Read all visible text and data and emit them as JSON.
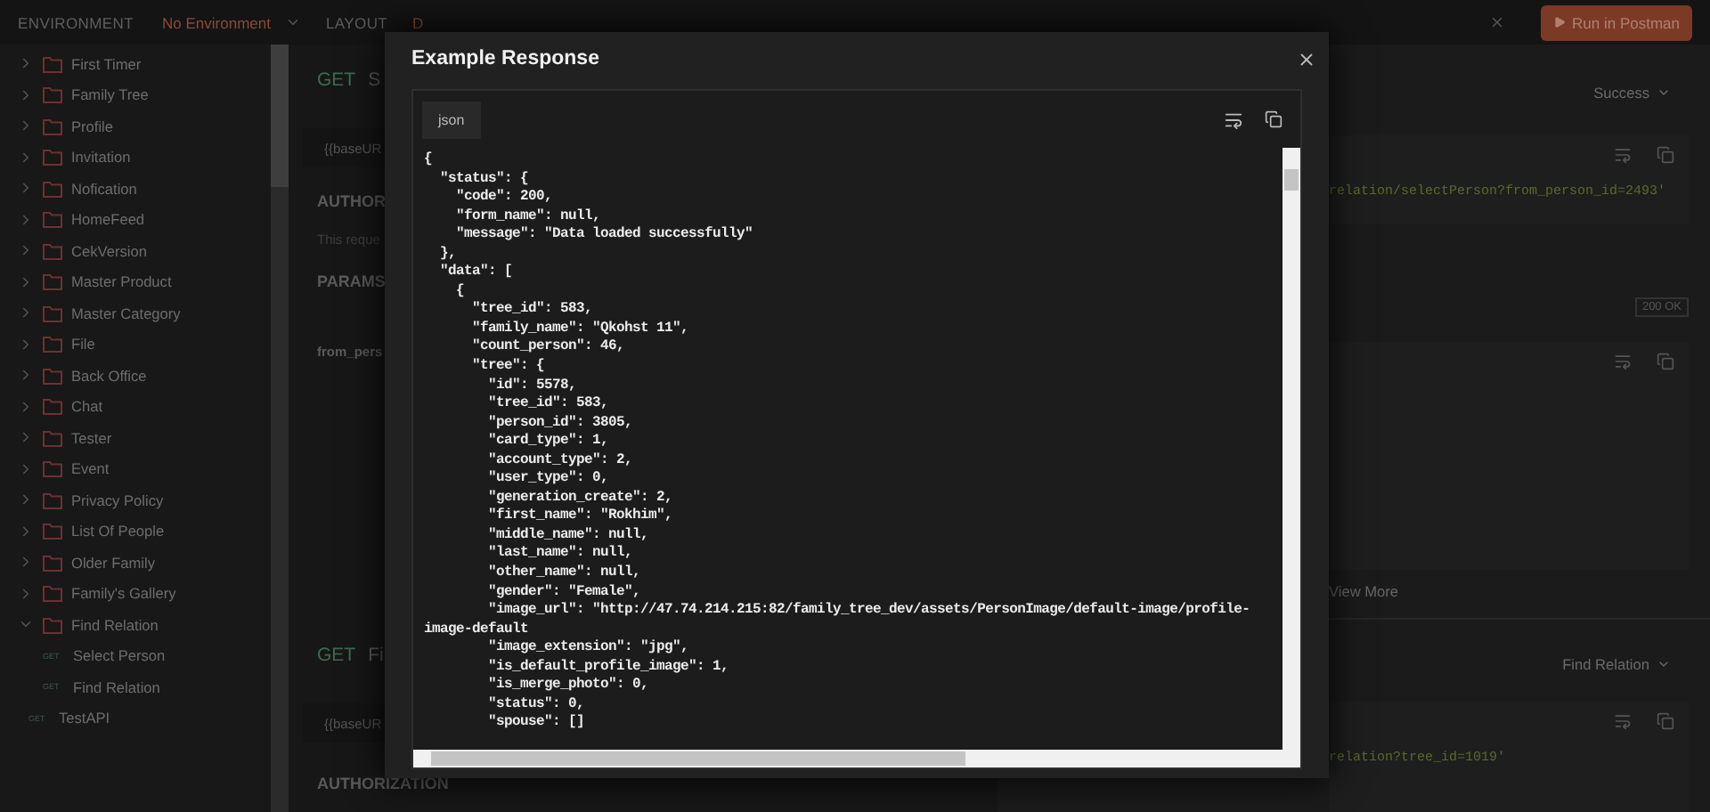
{
  "topbar": {
    "environment_label": "ENVIRONMENT",
    "environment_value": "No Environment",
    "layout_label": "LAYOUT",
    "layout_value": "D",
    "run_button": "Run in Postman"
  },
  "sidebar": {
    "items": [
      {
        "kind": "folder",
        "label": "First Timer",
        "expanded": false
      },
      {
        "kind": "folder",
        "label": "Family Tree",
        "expanded": false
      },
      {
        "kind": "folder",
        "label": "Profile",
        "expanded": false
      },
      {
        "kind": "folder",
        "label": "Invitation",
        "expanded": false
      },
      {
        "kind": "folder",
        "label": "Nofication",
        "expanded": false
      },
      {
        "kind": "folder",
        "label": "HomeFeed",
        "expanded": false
      },
      {
        "kind": "folder",
        "label": "CekVersion",
        "expanded": false
      },
      {
        "kind": "folder",
        "label": "Master Product",
        "expanded": false
      },
      {
        "kind": "folder",
        "label": "Master Category",
        "expanded": false
      },
      {
        "kind": "folder",
        "label": "File",
        "expanded": false
      },
      {
        "kind": "folder",
        "label": "Back Office",
        "expanded": false
      },
      {
        "kind": "folder",
        "label": "Chat",
        "expanded": false
      },
      {
        "kind": "folder",
        "label": "Tester",
        "expanded": false
      },
      {
        "kind": "folder",
        "label": "Event",
        "expanded": false
      },
      {
        "kind": "folder",
        "label": "Privacy Policy",
        "expanded": false
      },
      {
        "kind": "folder",
        "label": "List Of People",
        "expanded": false
      },
      {
        "kind": "folder",
        "label": "Older Family",
        "expanded": false
      },
      {
        "kind": "folder",
        "label": "Family's Gallery",
        "expanded": false
      },
      {
        "kind": "folder",
        "label": "Find Relation",
        "expanded": true,
        "children": [
          {
            "kind": "request",
            "method": "GET",
            "label": "Select Person"
          },
          {
            "kind": "request",
            "method": "GET",
            "label": "Find Relation"
          }
        ]
      },
      {
        "kind": "request",
        "method": "GET",
        "label": "TestAPI"
      }
    ]
  },
  "main": {
    "blocks": [
      {
        "kind": "request_title",
        "method": "GET",
        "name": "S"
      },
      {
        "kind": "url",
        "text": "{{baseUR"
      },
      {
        "kind": "heading",
        "text": "AUTHOR"
      },
      {
        "kind": "note",
        "text": "This reque"
      },
      {
        "kind": "heading",
        "text": "PARAMS"
      },
      {
        "kind": "param",
        "text": "from_pers"
      },
      {
        "kind": "request_title",
        "method": "GET",
        "name": "Fi"
      },
      {
        "kind": "url",
        "text": "{{baseUR"
      },
      {
        "kind": "heading",
        "text": "AUTHORIZATION"
      }
    ]
  },
  "right_panel": {
    "sections": [
      {
        "select": "Success",
        "snippet": "relation/selectPerson?from_person_id=2493'",
        "status": "200 OK",
        "view_more": "View More"
      },
      {
        "select": "Find Relation",
        "snippet": "relation?tree_id=1019'"
      }
    ]
  },
  "modal": {
    "title": "Example Response",
    "tab": "json",
    "code_lines": [
      "{",
      "  \"status\": {",
      "    \"code\": 200,",
      "    \"form_name\": null,",
      "    \"message\": \"Data loaded successfully\"",
      "  },",
      "  \"data\": [",
      "    {",
      "      \"tree_id\": 583,",
      "      \"family_name\": \"Qkohst 11\",",
      "      \"count_person\": 46,",
      "      \"tree\": {",
      "        \"id\": 5578,",
      "        \"tree_id\": 583,",
      "        \"person_id\": 3805,",
      "        \"card_type\": 1,",
      "        \"account_type\": 2,",
      "        \"user_type\": 0,",
      "        \"generation_create\": 2,",
      "        \"first_name\": \"Rokhim\",",
      "        \"middle_name\": null,",
      "        \"last_name\": null,",
      "        \"other_name\": null,",
      "        \"gender\": \"Female\",",
      "        \"image_url\": \"http://47.74.214.215:82/family_tree_dev/assets/PersonImage/default-image/profile-image-default",
      "        \"image_extension\": \"jpg\",",
      "        \"is_default_profile_image\": 1,",
      "        \"is_merge_photo\": 0,",
      "        \"status\": 0,",
      "        \"spouse\": []"
    ]
  }
}
